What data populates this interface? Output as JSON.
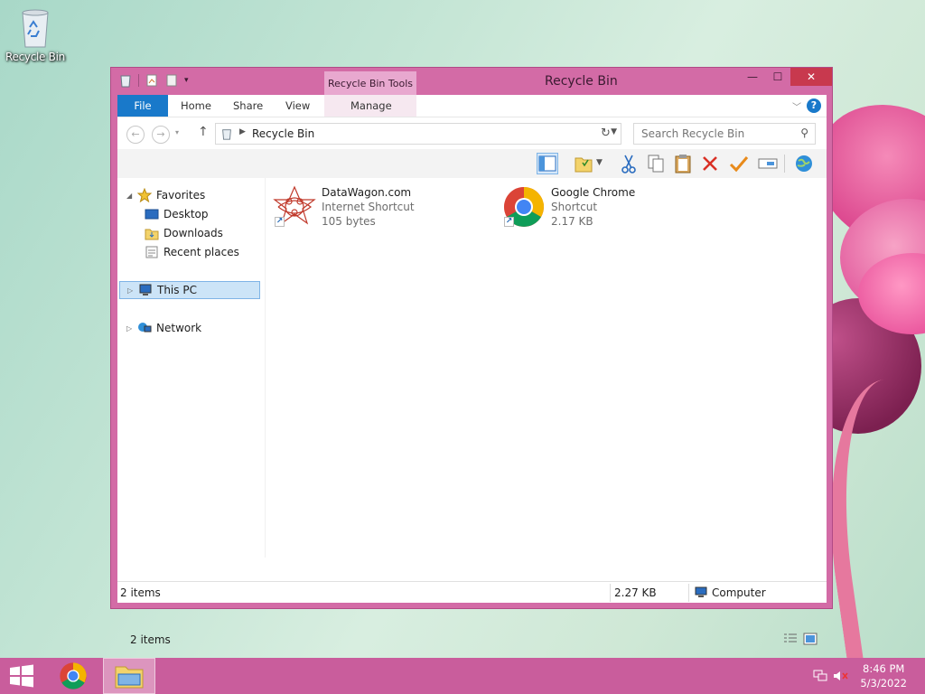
{
  "desktop": {
    "recycle_bin_label": "Recycle Bin"
  },
  "window": {
    "title": "Recycle Bin",
    "context_tab_group": "Recycle Bin Tools",
    "controls": {
      "minimize": "—",
      "maximize": "☐",
      "close": "✕"
    }
  },
  "ribbon": {
    "tabs": [
      {
        "label": "File"
      },
      {
        "label": "Home"
      },
      {
        "label": "Share"
      },
      {
        "label": "View"
      },
      {
        "label": "Manage"
      }
    ],
    "help": "?"
  },
  "address": {
    "path": "Recycle Bin",
    "search_placeholder": "Search Recycle Bin"
  },
  "nav": {
    "favorites": "Favorites",
    "desktop": "Desktop",
    "downloads": "Downloads",
    "recent": "Recent places",
    "this_pc": "This PC",
    "network": "Network"
  },
  "files": [
    {
      "name": "DataWagon.com",
      "type": "Internet Shortcut",
      "size": "105 bytes",
      "icon": "datawagon-icon"
    },
    {
      "name": "Google Chrome",
      "type": "Shortcut",
      "size": "2.17 KB",
      "icon": "chrome-icon"
    }
  ],
  "content_footer": {
    "item_count": "2 items"
  },
  "statusbar": {
    "items": "2 items",
    "size": "2.27 KB",
    "location": "Computer"
  },
  "taskbar": {
    "time": "8:46 PM",
    "date": "5/3/2022"
  },
  "colors": {
    "window_frame": "#d36ba6",
    "accent_blue": "#1979ca",
    "taskbar": "#c95d9c",
    "close_button": "#c8394e"
  }
}
